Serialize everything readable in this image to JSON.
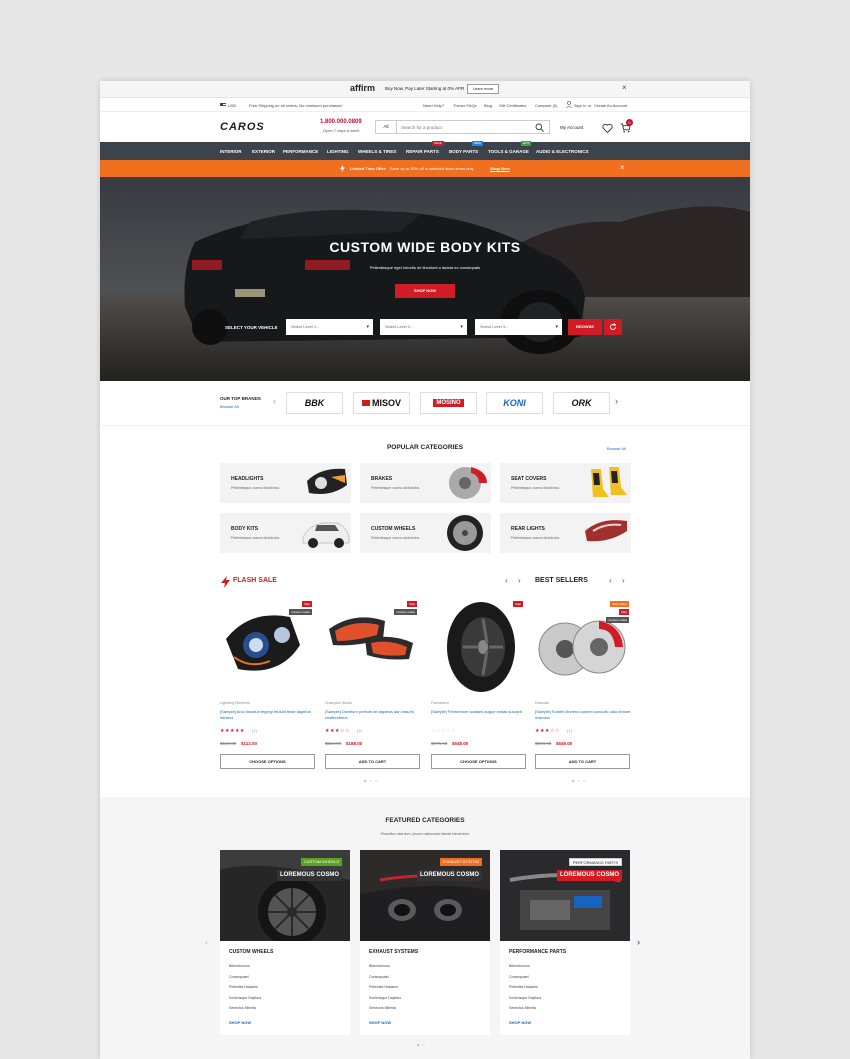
{
  "promo": {
    "logo": "affirm",
    "text": "Buy Now, Pay Later Starting at 0% APR",
    "button": "Learn more",
    "close": "×"
  },
  "util": {
    "currency": "USD",
    "shipping": "Free Shipping on all orders. No minimum purchases*",
    "links": [
      "Need Help?",
      "Theme FAQs",
      "Blog",
      "Gift Certificates",
      "Compare (0)"
    ],
    "signin": "Sign In",
    "or": "or",
    "create": "Create An Account"
  },
  "header": {
    "logo": "CAROS",
    "phone": "1.800.000.0809",
    "hours": "Open 7 days a week",
    "search_cat": "All",
    "search_placeholder": "Search for a product",
    "my_account": "My Account",
    "cart_count": "0"
  },
  "nav": {
    "items": [
      "INTERIOR",
      "EXTERIOR",
      "PERFORMANCE",
      "LIGHTING",
      "WHEELS & TIRES",
      "REPAIR PARTS",
      "BODY PARTS",
      "TOOLS & GARAGE",
      "AUDIO & ELECTRONICS"
    ],
    "badges": [
      {
        "label": "SALE",
        "color": "#d01c24"
      },
      {
        "label": "NEW",
        "color": "#1e88e5"
      },
      {
        "label": "HOT",
        "color": "#43a047"
      }
    ]
  },
  "offer": {
    "label": "Limited Time Offer:",
    "text": "Save up to 20% off in selected stock items only",
    "link": "Shop Now",
    "close": "×"
  },
  "hero": {
    "title": "CUSTOM WIDE BODY KITS",
    "subtitle": "Pellentesque eget lobortis de tincidunt a lacinia ex consequats",
    "button": "SHOP NOW",
    "select_label": "SELECT YOUR VEHICLE",
    "selects": [
      "Select Level 1...",
      "Select Level 2...",
      "Select Level 3..."
    ],
    "browse": "BROWSE"
  },
  "brands": {
    "title": "OUR TOP BRANDS",
    "browse_all": "Browse All",
    "logos": [
      "BBK",
      "MISOV",
      "MOSINO",
      "KONI",
      "ORK"
    ]
  },
  "popular": {
    "title": "POPULAR CATEGORIES",
    "browse_all": "Browse All",
    "items": [
      {
        "title": "HEADLIGHTS",
        "desc": "Pellentesque cosmo dictolorios"
      },
      {
        "title": "BRAKES",
        "desc": "Pellentesque cosmo dictolorios"
      },
      {
        "title": "SEAT COVERS",
        "desc": "Pellentesque cosmo dictolorios"
      },
      {
        "title": "BODY KITS",
        "desc": "Pellentesque cosmo dictolorios"
      },
      {
        "title": "CUSTOM WHEELS",
        "desc": "Pellentesque cosmo dictolorios"
      },
      {
        "title": "REAR LIGHTS",
        "desc": "Pellentesque cosmo dictolorios"
      }
    ]
  },
  "flash": {
    "title": "FLASH SALE",
    "products": [
      {
        "brand": "Lightning Elements",
        "name": "[Sample] Arcu tincidun tegeny teuslat teste dapibus mintect",
        "stars": "★★★★★",
        "reviews": "(2)",
        "old": "$128.00",
        "new": "$112.00",
        "button": "CHOOSE OPTIONS",
        "tags": [
          {
            "label": "Sale",
            "color": "#d01c24"
          },
          {
            "label": "Custom Label",
            "color": "#555555"
          }
        ]
      },
      {
        "brand": "Champion Studio",
        "name": "[Sample] Dictntum pretium an dapibus dan mauris vestibmtetus",
        "stars": "★★★☆☆",
        "reviews": "(2)",
        "old": "$224.00",
        "new": "$188.00",
        "button": "ADD TO CART",
        "tags": [
          {
            "label": "Sale",
            "color": "#d01c24"
          },
          {
            "label": "Custom Label",
            "color": "#555555"
          }
        ]
      },
      {
        "brand": "Formantion",
        "name": "[Sample] Fermentum sodales augue minas suscipit",
        "stars": "☆☆☆☆☆",
        "reviews": "",
        "old": "$875.00",
        "new": "$648.00",
        "button": "CHOOSE OPTIONS",
        "tags": [
          {
            "label": "Sale",
            "color": "#d01c24"
          }
        ]
      }
    ]
  },
  "bestsellers": {
    "title": "BEST SELLERS",
    "products": [
      {
        "brand": "Endurant",
        "name": "[Sample] Susieri dinnera contem consultc odio lectore maeninx",
        "stars": "★★★☆☆",
        "reviews": "(1)",
        "old": "$698.00",
        "new": "$649.00",
        "button": "ADD TO CART",
        "tags": [
          {
            "label": "Best Seller",
            "color": "#f07020"
          },
          {
            "label": "Sale",
            "color": "#d01c24"
          },
          {
            "label": "Custom Label",
            "color": "#555555"
          }
        ]
      }
    ]
  },
  "featured": {
    "title": "FEATURED CATEGORIES",
    "subtitle": "Phasellus interdum, ipsum malesuada blandit elementum",
    "cards": [
      {
        "tag": "CUSTOM WHEELS",
        "tag_color": "#5aa320",
        "overlay": "LOREMOUS COSMO",
        "overlay_color": "#333333",
        "name": "CUSTOM WHEELS",
        "links": [
          "Bibendumrus",
          "Consequatel",
          "Pellentes Haslamu",
          "Scelerisque Dapibus",
          "Senectus Milenta"
        ],
        "shop": "SHOP NOW"
      },
      {
        "tag": "EXHAUST SYSTEM",
        "tag_color": "#f07020",
        "overlay": "LOREMOUS COSMO",
        "overlay_color": "#333333",
        "name": "EXHAUST SYSTEMS",
        "links": [
          "Bibendumrus",
          "Consequatel",
          "Pellentes Haslamu",
          "Scelerisque Dapibus",
          "Senectus Milenta"
        ],
        "shop": "SHOP NOW"
      },
      {
        "tag": "PERFORMANCE PARTS",
        "tag_color": "#ffffff",
        "overlay": "LOREMOUS COSMO",
        "overlay_color": "#d01c24",
        "name": "PERFORMANCE PARTS",
        "links": [
          "Bibendumrus",
          "Consequatel",
          "Pellentes Haslamu",
          "Scelerisque Dapibus",
          "Senectus Milenta"
        ],
        "shop": "SHOP NOW"
      }
    ]
  }
}
